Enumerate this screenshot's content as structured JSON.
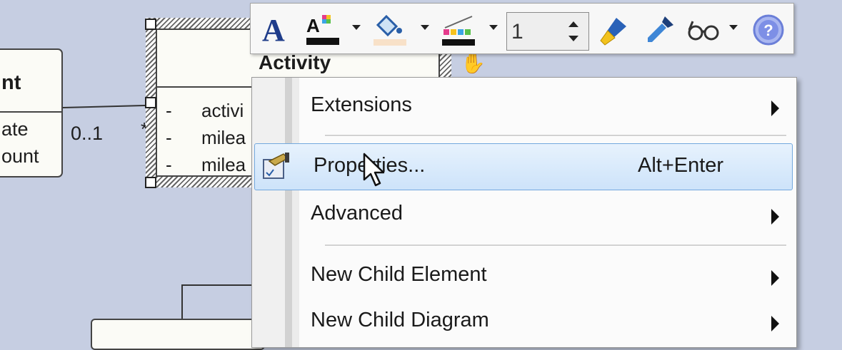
{
  "diagram": {
    "left_class": {
      "title_fragment": "nt",
      "attr1": "ate",
      "attr2": "ount"
    },
    "association": {
      "left_multiplicity": "0..1",
      "right_multiplicity": "*"
    },
    "activity_class": {
      "name": "Activity",
      "attributes": [
        {
          "vis": "-",
          "name": "activi"
        },
        {
          "vis": "-",
          "name": "milea"
        },
        {
          "vis": "-",
          "name": "milea"
        }
      ]
    }
  },
  "toolbar": {
    "tools": [
      {
        "icon": "font-icon",
        "has_dropdown": false
      },
      {
        "icon": "font-color-icon",
        "has_dropdown": true
      },
      {
        "icon": "fill-color-icon",
        "has_dropdown": true
      },
      {
        "icon": "line-color-icon",
        "has_dropdown": true
      },
      {
        "icon": "format-painter-icon",
        "has_dropdown": false
      },
      {
        "icon": "eyedropper-icon",
        "has_dropdown": false
      },
      {
        "icon": "view-glasses-icon",
        "has_dropdown": true
      },
      {
        "icon": "help-icon",
        "has_dropdown": false
      }
    ],
    "line_width_value": "1"
  },
  "context_menu": {
    "items": [
      {
        "label": "Extensions",
        "shortcut": "",
        "submenu": true
      },
      {
        "label": "Properties...",
        "shortcut": "Alt+Enter",
        "submenu": false,
        "highlighted": true,
        "icon": "properties-icon"
      },
      {
        "label": "Advanced",
        "shortcut": "",
        "submenu": true
      },
      {
        "label": "New Child Element",
        "shortcut": "",
        "submenu": true
      },
      {
        "label": "New Child Diagram",
        "shortcut": "",
        "submenu": true
      }
    ]
  },
  "colors": {
    "canvas": "#c6cee2",
    "highlight_border": "#73a8de",
    "help_icon": "#6b7fd8"
  }
}
